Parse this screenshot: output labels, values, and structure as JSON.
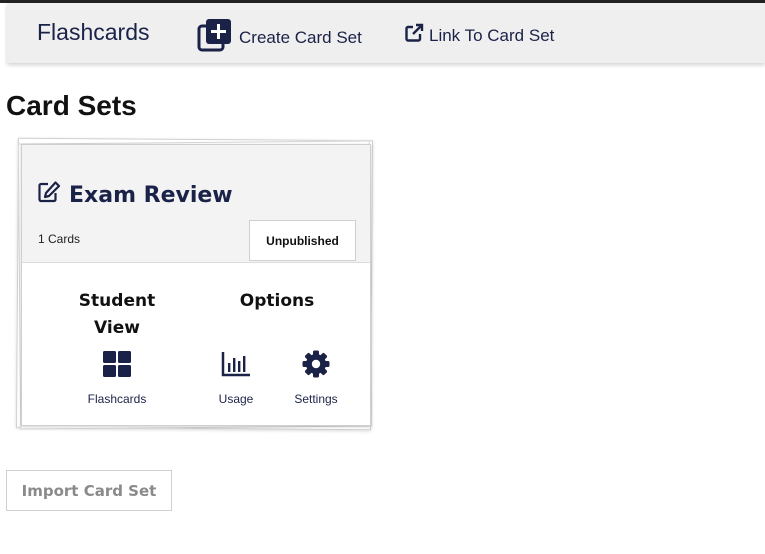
{
  "navbar": {
    "brand": "Flashcards",
    "create_label": "Create Card Set",
    "link_label": "Link To Card Set"
  },
  "page": {
    "title": "Card Sets"
  },
  "card_set": {
    "title": "Exam Review",
    "count_text": "1 Cards",
    "status": "Unpublished",
    "student_view_heading": "Student View",
    "options_heading": "Options",
    "actions": {
      "flashcards": "Flashcards",
      "usage": "Usage",
      "settings": "Settings"
    }
  },
  "import_label": "Import Card Set",
  "colors": {
    "accent_navy": "#1b2248",
    "navbar_bg": "#efefef",
    "card_head_bg": "#f3f3f3",
    "disabled_text": "#8a8a8a"
  },
  "icons": {
    "create": "plus-square-stack-icon",
    "link": "external-link-icon",
    "edit": "edit-pencil-icon",
    "flashcards": "grid-icon",
    "usage": "bar-chart-icon",
    "settings": "gear-icon"
  }
}
